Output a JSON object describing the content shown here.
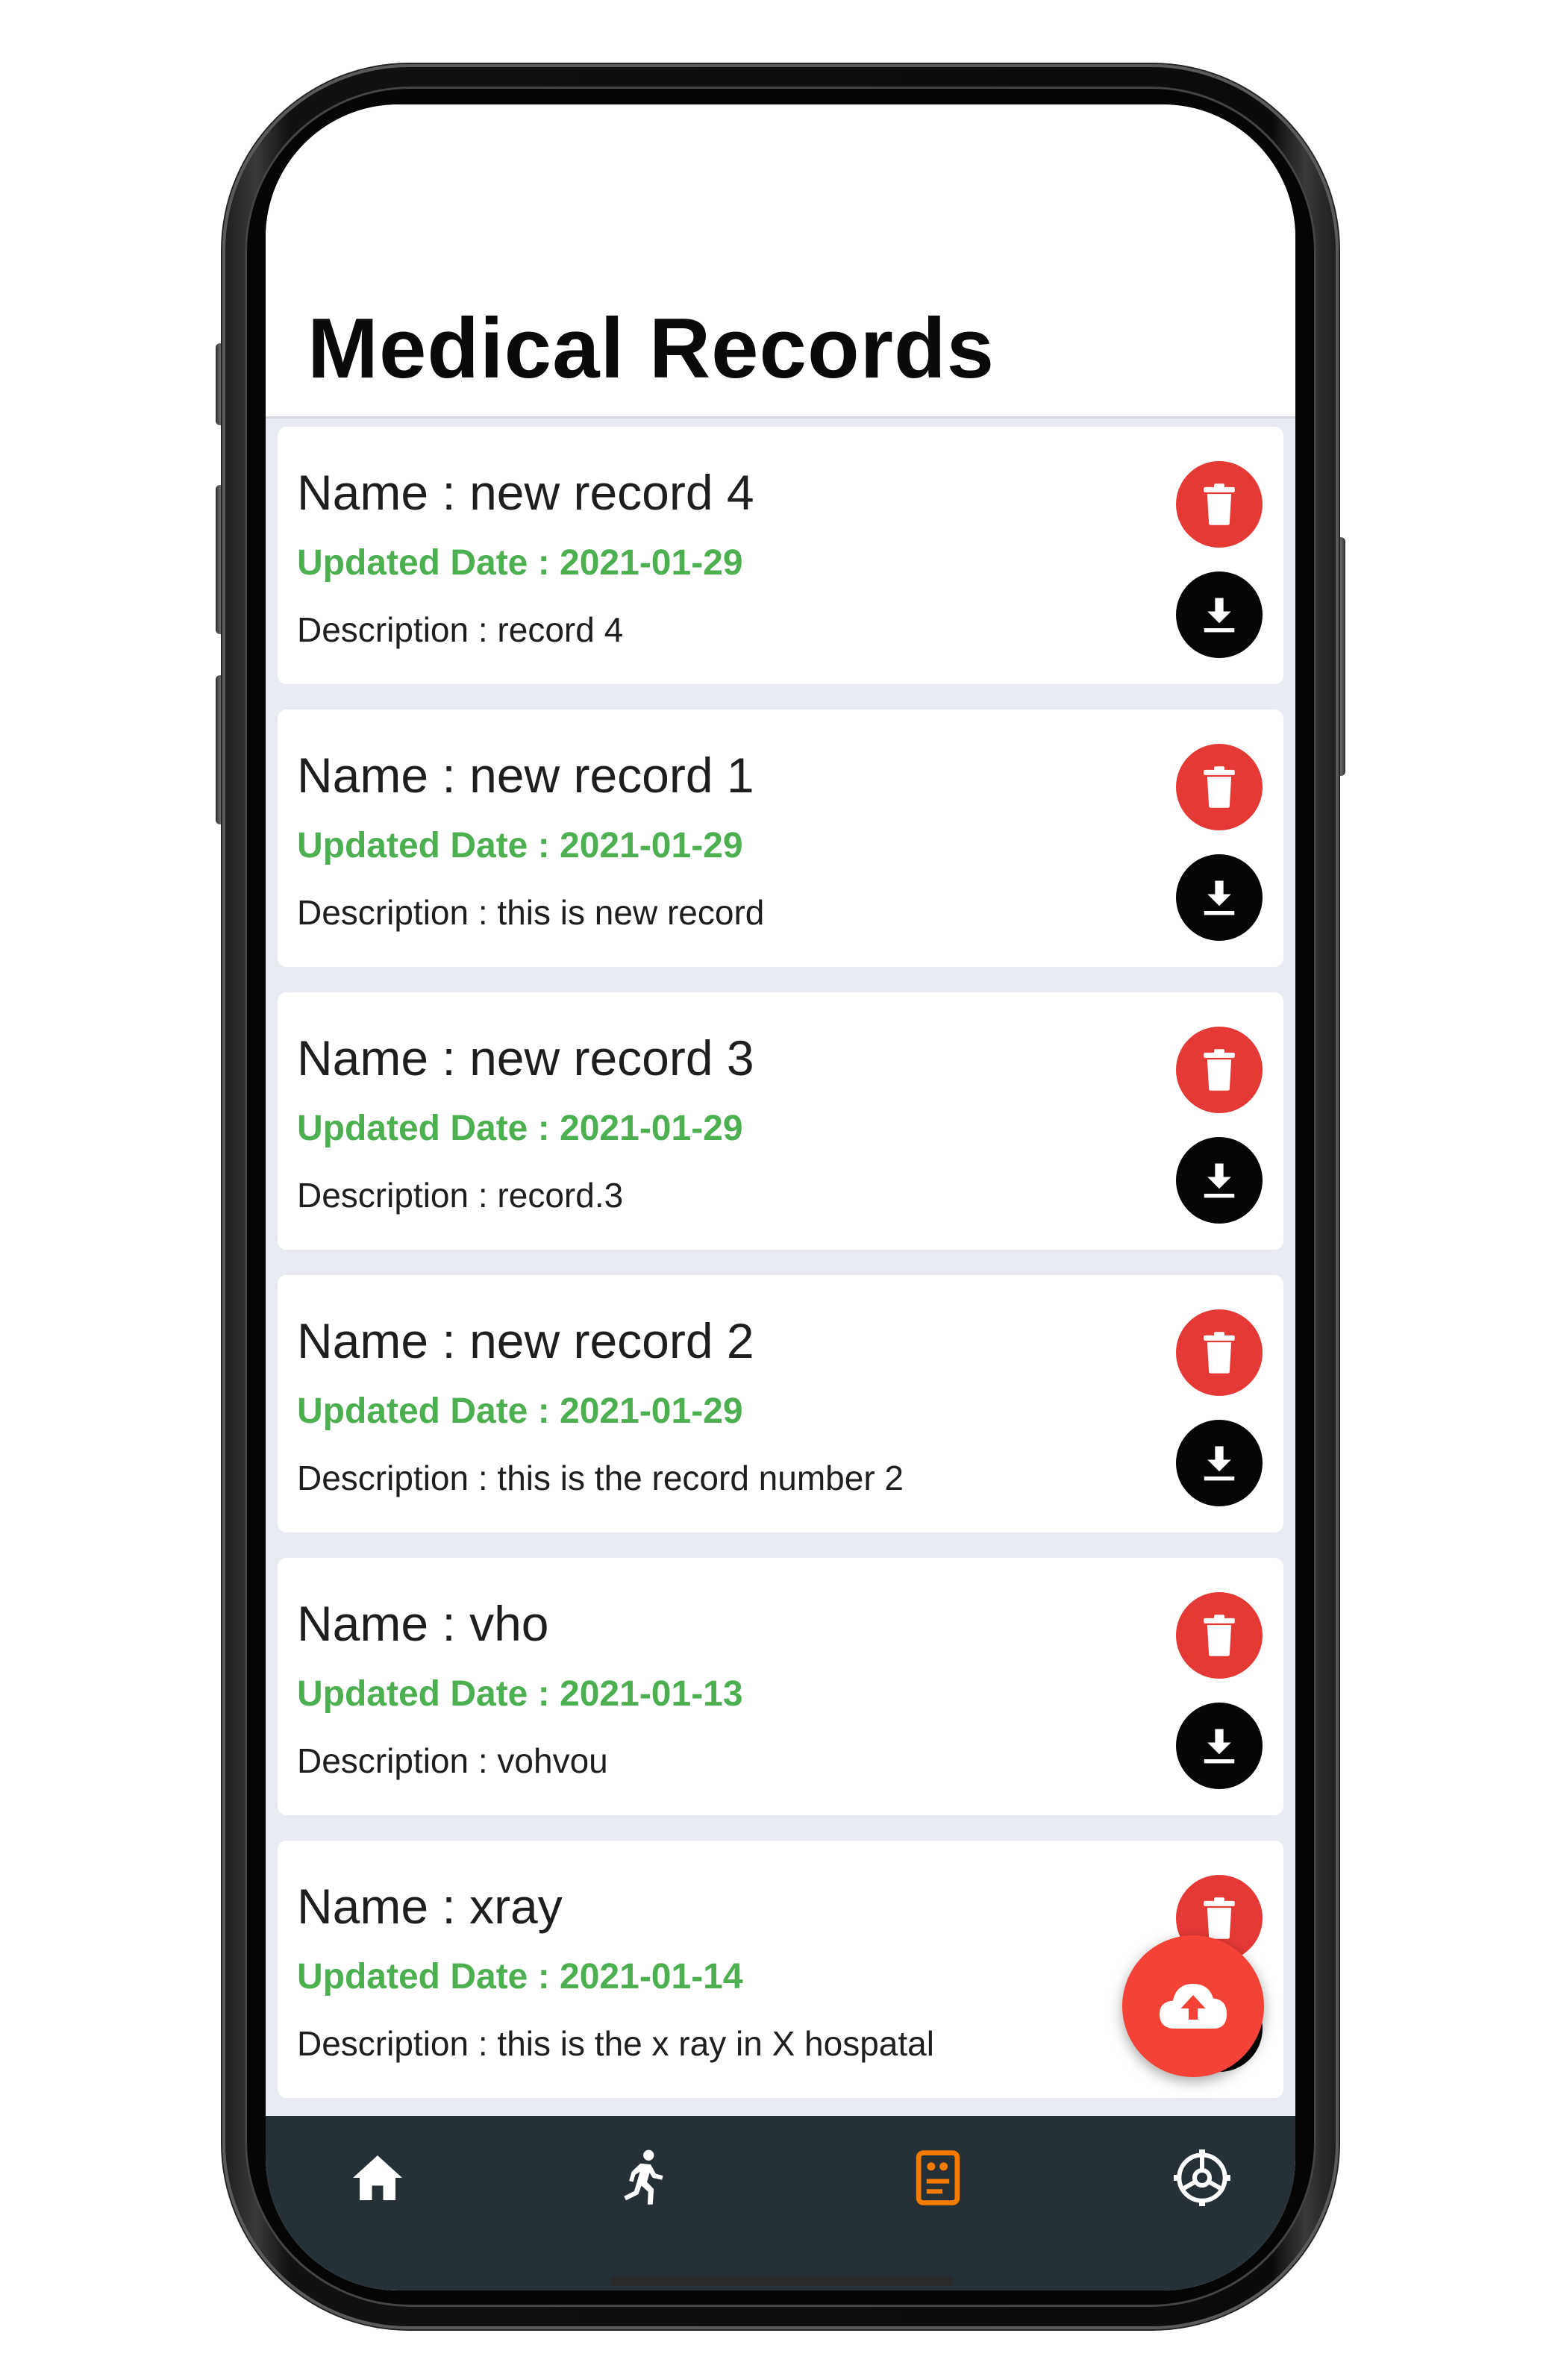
{
  "header": {
    "title": "Medical Records"
  },
  "records": [
    {
      "name": "Name : new record 4",
      "date": "Updated Date : 2021-01-29",
      "description": "Description : record 4"
    },
    {
      "name": "Name : new record 1",
      "date": "Updated Date : 2021-01-29",
      "description": "Description : this is new record"
    },
    {
      "name": "Name : new record 3",
      "date": "Updated Date : 2021-01-29",
      "description": "Description : record.3"
    },
    {
      "name": "Name : new record 2",
      "date": "Updated Date : 2021-01-29",
      "description": "Description : this is the record number 2"
    },
    {
      "name": "Name : vho",
      "date": "Updated Date : 2021-01-13",
      "description": "Description : vohvou"
    },
    {
      "name": "Name : xray",
      "date": "Updated Date : 2021-01-14",
      "description": "Description : this is the x ray in X hospatal"
    }
  ],
  "icons": {
    "delete": "trash-icon",
    "download": "download-icon",
    "upload": "cloud-upload-icon",
    "nav": [
      "home-icon",
      "running-person-icon",
      "records-icon",
      "settings-gear-icon"
    ]
  },
  "nav": {
    "active": "records"
  },
  "colors": {
    "accent_green": "#4caf50",
    "delete_red": "#e53935",
    "fab_red": "#f44336",
    "nav_bg": "#263037",
    "nav_active": "#f57c00",
    "list_bg": "#e9ebf3"
  }
}
